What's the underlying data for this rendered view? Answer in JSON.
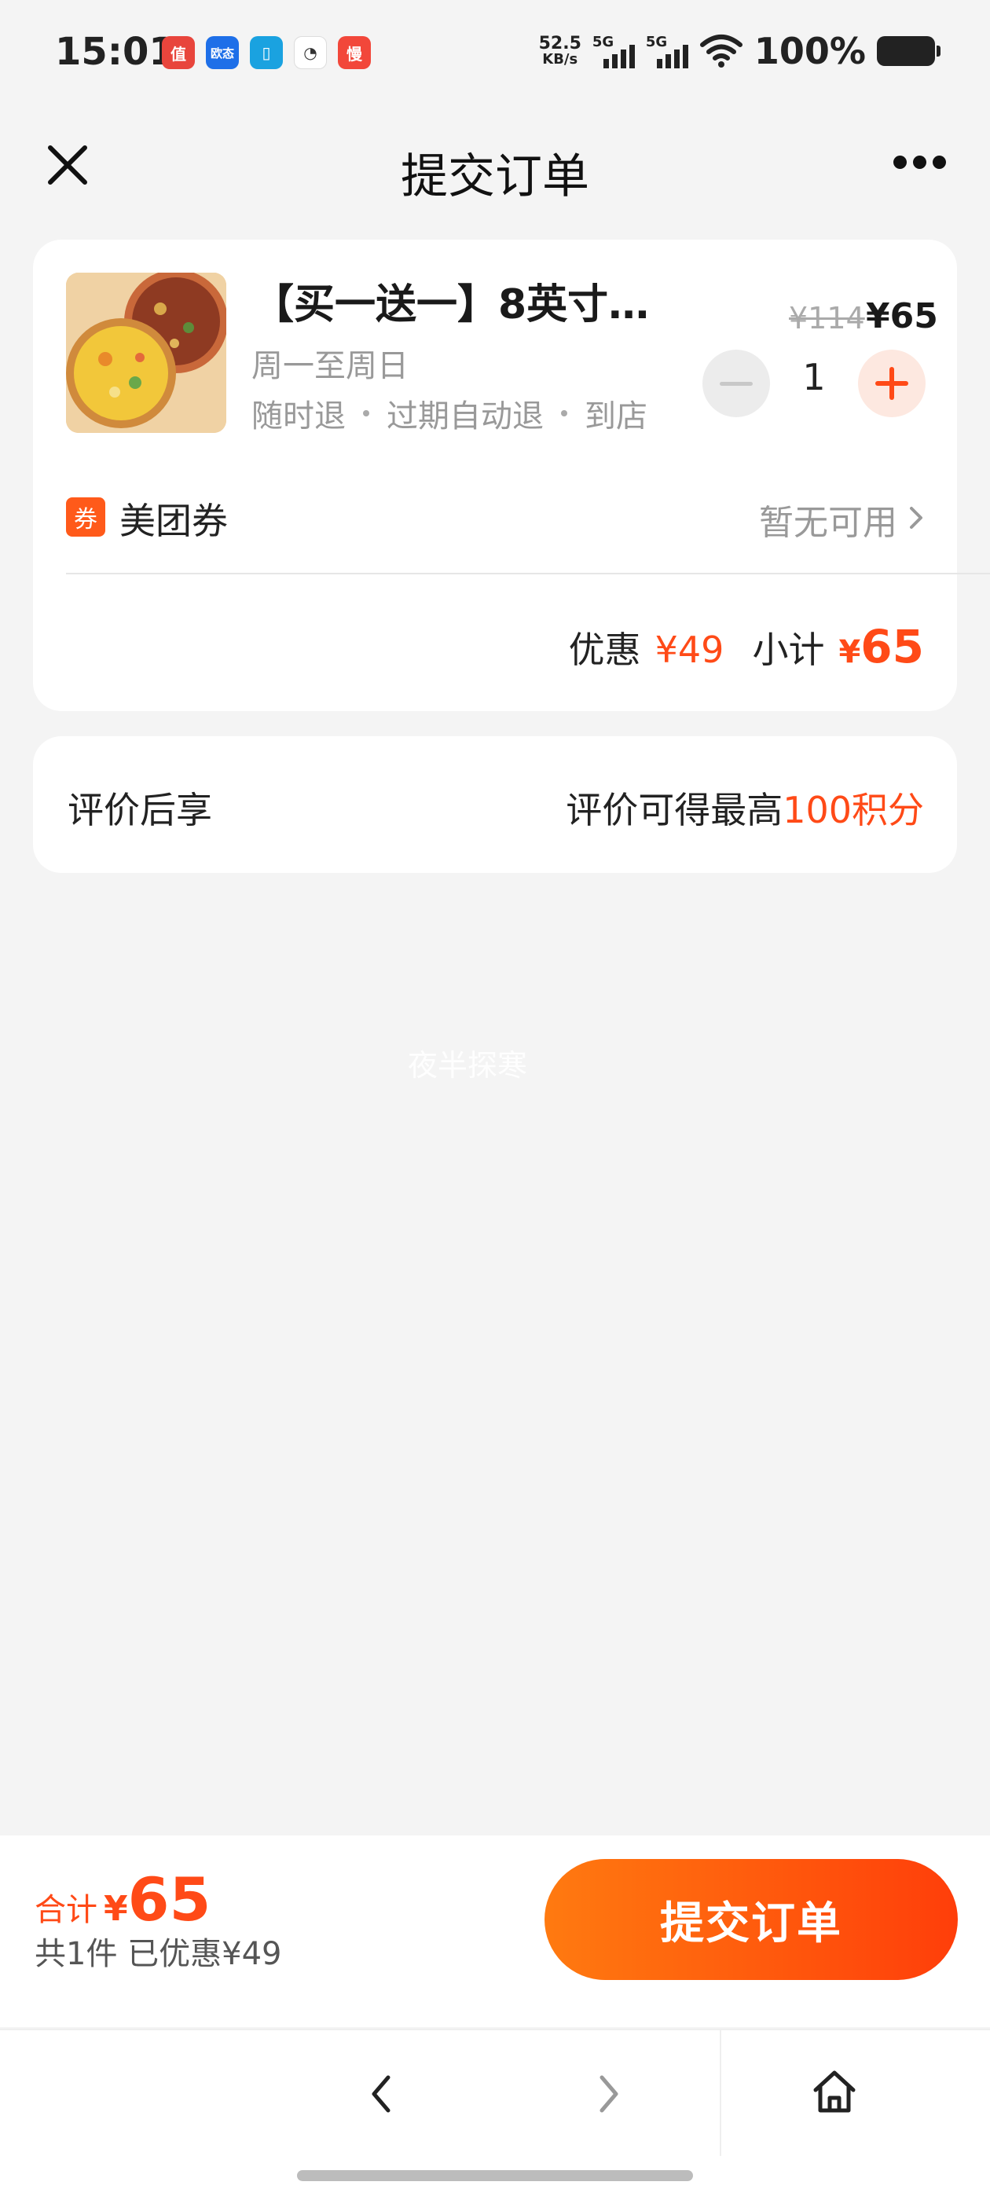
{
  "status_bar": {
    "time": "15:01",
    "apps": [
      {
        "icon": "app-red-icon",
        "text": "值",
        "color": "#e8453c"
      },
      {
        "icon": "app-blue-icon",
        "text": "欧态",
        "color": "#1e6fe8"
      },
      {
        "icon": "app-cyan-icon",
        "text": "▯",
        "color": "#1aa2e0"
      },
      {
        "icon": "clock-app-icon",
        "text": "◔",
        "color": "#ffffff"
      },
      {
        "icon": "app-orange-icon",
        "text": "慢",
        "color": "#f2473a"
      }
    ],
    "net_speed_value": "52.5",
    "net_speed_unit": "KB/s",
    "signal1_label": "5G",
    "signal2_label": "5G",
    "battery": "100%"
  },
  "nav": {
    "title": "提交订单"
  },
  "order": {
    "product_title": "【买一送一】8英寸…",
    "product_sub": "周一至周日",
    "policies": [
      "随时退",
      "过期自动退",
      "到店"
    ],
    "price_old": "¥114",
    "price_new": "¥65",
    "quantity": "1",
    "coupon_badge": "券",
    "coupon_label": "美团券",
    "coupon_status": "暂无可用",
    "discount_label": "优惠",
    "discount_value": "¥49",
    "subtotal_label": "小计",
    "subtotal_currency": "¥",
    "subtotal_value": "65"
  },
  "review": {
    "label": "评价后享",
    "value_prefix": "评价可得最高",
    "value_highlight": "100积分"
  },
  "watermark": "夜半探寒",
  "bottom": {
    "total_label": "合计",
    "total_currency": "¥",
    "total_value": "65",
    "summary": "共1件  已优惠¥49",
    "submit_label": "提交订单"
  },
  "colors": {
    "accent": "#ff4a17",
    "button_gradient_start": "#ff7a10",
    "button_gradient_end": "#ff3e0a",
    "background": "#f4f4f4"
  }
}
